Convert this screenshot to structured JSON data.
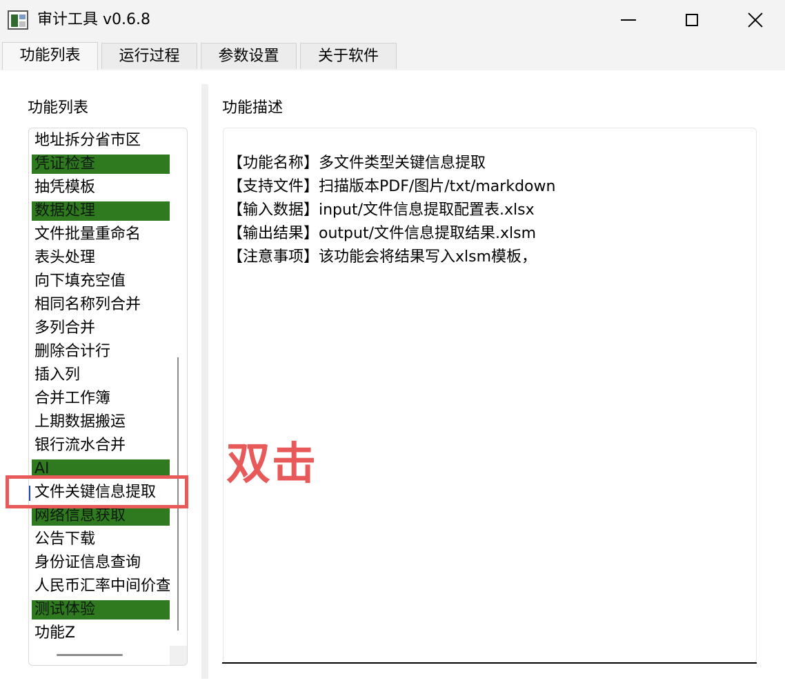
{
  "window": {
    "title": "审计工具 v0.6.8"
  },
  "tabs": [
    {
      "label": "功能列表",
      "active": true
    },
    {
      "label": "运行过程",
      "active": false
    },
    {
      "label": "参数设置",
      "active": false
    },
    {
      "label": "关于软件",
      "active": false
    }
  ],
  "left_panel": {
    "label": "功能列表",
    "items": [
      {
        "label": "地址拆分省市区",
        "category": false
      },
      {
        "label": "凭证检查",
        "category": true
      },
      {
        "label": "抽凭模板",
        "category": false
      },
      {
        "label": "数据处理",
        "category": true
      },
      {
        "label": "文件批量重命名",
        "category": false
      },
      {
        "label": "表头处理",
        "category": false
      },
      {
        "label": "向下填充空值",
        "category": false
      },
      {
        "label": "相同名称列合并",
        "category": false
      },
      {
        "label": "多列合并",
        "category": false
      },
      {
        "label": "删除合计行",
        "category": false
      },
      {
        "label": "插入列",
        "category": false
      },
      {
        "label": "合并工作簿",
        "category": false
      },
      {
        "label": "上期数据搬运",
        "category": false
      },
      {
        "label": "银行流水合并",
        "category": false
      },
      {
        "label": "AI",
        "category": true
      },
      {
        "label": "文件关键信息提取",
        "category": false,
        "selected": true
      },
      {
        "label": "网络信息获取",
        "category": true
      },
      {
        "label": "公告下载",
        "category": false
      },
      {
        "label": "身份证信息查询",
        "category": false
      },
      {
        "label": "人民币汇率中间价查询",
        "category": false
      },
      {
        "label": "测试体验",
        "category": true
      },
      {
        "label": "功能Z",
        "category": false
      }
    ]
  },
  "right_panel": {
    "label": "功能描述",
    "lines": [
      "【功能名称】多文件类型关键信息提取",
      "【支持文件】扫描版本PDF/图片/txt/markdown",
      "【输入数据】input/文件信息提取配置表.xlsx",
      "【输出结果】output/文件信息提取结果.xlsm",
      "【注意事项】该功能会将结果写入xlsm模板，"
    ]
  },
  "annotation": {
    "text": "双击"
  },
  "colors": {
    "category_highlight": "#2f7a1f",
    "annotation": "#e85a5a"
  }
}
